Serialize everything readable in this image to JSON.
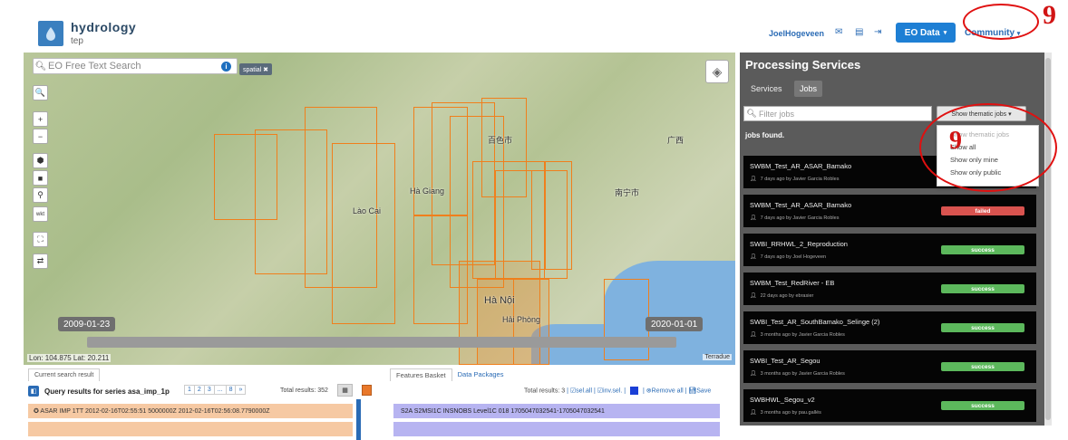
{
  "header": {
    "brand_title": "hydrology",
    "brand_sub": "tep",
    "user": "JoelHogeveen",
    "eo_data_button": "EO Data",
    "community_button": "Community"
  },
  "annotations": {
    "marker_top": "9",
    "marker_dropdown": "9"
  },
  "map": {
    "search_placeholder": "EO Free Text Search",
    "spatial_tag": "spatial ✖",
    "tools": [
      "🔍",
      "+",
      "−",
      "⬢",
      "■",
      "⚲",
      "wkt",
      "⛶",
      "⇄"
    ],
    "labels": [
      "Hà Giang",
      "Lào Cai",
      "Hà Nội",
      "Hải Phòng",
      "南宁市",
      "百色市",
      "广西"
    ],
    "time_start": "2009-01-23",
    "time_end": "2020-01-01",
    "coords": "Lon: 104.875 Lat: 20.211",
    "attribution": "Terradue"
  },
  "results": {
    "tab": "Current search result",
    "query": "Query results for series asa_imp_1p",
    "pages": [
      "1",
      "2",
      "3",
      "...",
      "8",
      "»"
    ],
    "total": "Total results: 352",
    "rows": [
      "✪ ASAR IMP 1TT 2012-02-16T02:55:51 5000000Z 2012-02-16T02:56:08.7790000Z",
      ""
    ]
  },
  "basket": {
    "tab_features": "Features Basket",
    "tab_packages": "Data Packages",
    "total": "Total results: 3",
    "sel_all": "sel.all",
    "inv_sel": "inv.sel.",
    "remove_all": "Remove all",
    "save": "Save",
    "rows": [
      "S2A S2MSI1C INSNOBS Level1C 018 1705047032541-1705047032541",
      ""
    ]
  },
  "panel": {
    "title": "Processing Services",
    "tab_services": "Services",
    "tab_jobs": "Jobs",
    "filter_placeholder": "Filter jobs",
    "show_button": "Show thematic jobs ▾",
    "jobs_found": "jobs found.",
    "dropdown": [
      "Show thematic jobs",
      "Show all",
      "Show only mine",
      "Show only public"
    ],
    "jobs": [
      {
        "name": "SWBM_Test_AR_ASAR_Bamako",
        "meta": "7 days ago by Javier Garcia Robles",
        "status": "",
        "color": ""
      },
      {
        "name": "SWBM_Test_AR_ASAR_Bamako",
        "meta": "7 days ago by Javier Garcia Robles",
        "status": "failed",
        "color": "#d9534f"
      },
      {
        "name": "SWBI_RRHWL_2_Reproduction",
        "meta": "7 days ago by Joel Hogeveen",
        "status": "success",
        "color": "#5cb85c"
      },
      {
        "name": "SWBM_Test_RedRiver - EB",
        "meta": "22 days ago by ebrasier",
        "status": "success",
        "color": "#5cb85c"
      },
      {
        "name": "SWBI_Test_AR_SouthBamako_Selinge (2)",
        "meta": "3 months ago by Javier Garcia Robles",
        "status": "success",
        "color": "#5cb85c"
      },
      {
        "name": "SWBI_Test_AR_Segou",
        "meta": "3 months ago by Javier Garcia Robles",
        "status": "success",
        "color": "#5cb85c"
      },
      {
        "name": "SWBHWL_Segou_v2",
        "meta": "3 months ago by pau.gallés",
        "status": "success",
        "color": "#5cb85c"
      }
    ]
  },
  "colors": {
    "accent": "#1e7fd4",
    "footprint": "#f07f1c",
    "failed": "#d9534f",
    "success": "#5cb85c"
  }
}
